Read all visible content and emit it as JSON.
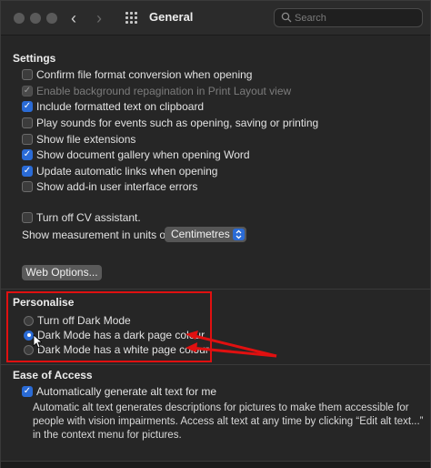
{
  "window": {
    "title": "General"
  },
  "search": {
    "placeholder": "Search"
  },
  "settings": {
    "heading": "Settings",
    "options": [
      {
        "label": "Confirm file format conversion when opening",
        "checked": false,
        "enabled": true
      },
      {
        "label": "Enable background repagination in Print Layout view",
        "checked": true,
        "enabled": false
      },
      {
        "label": "Include formatted text on clipboard",
        "checked": true,
        "enabled": true
      },
      {
        "label": "Play sounds for events such as opening, saving or printing",
        "checked": false,
        "enabled": true
      },
      {
        "label": "Show file extensions",
        "checked": false,
        "enabled": true
      },
      {
        "label": "Show document gallery when opening Word",
        "checked": true,
        "enabled": true
      },
      {
        "label": "Update automatic links when opening",
        "checked": true,
        "enabled": true
      },
      {
        "label": "Show add-in user interface errors",
        "checked": false,
        "enabled": true
      },
      {
        "label": "Turn off CV assistant.",
        "checked": false,
        "enabled": true
      }
    ],
    "units_label": "Show measurement in units of:",
    "units_value": "Centimetres",
    "web_options_label": "Web Options..."
  },
  "personalise": {
    "heading": "Personalise",
    "options": [
      {
        "label": "Turn off Dark Mode",
        "selected": false
      },
      {
        "label": "Dark Mode has a dark page colour",
        "selected": true
      },
      {
        "label": "Dark Mode has a white page colour",
        "selected": false
      }
    ]
  },
  "accessibility": {
    "heading": "Ease of Access",
    "alt_text_label": "Automatically generate alt text for me",
    "alt_text_checked": true,
    "description": "Automatic alt text generates descriptions for pictures to make them accessible for people with vision impairments. Access alt text at any time by clicking “Edit alt text...” in the context menu for pictures."
  },
  "colors": {
    "accent": "#2a6bd6",
    "highlight": "#e01010"
  }
}
